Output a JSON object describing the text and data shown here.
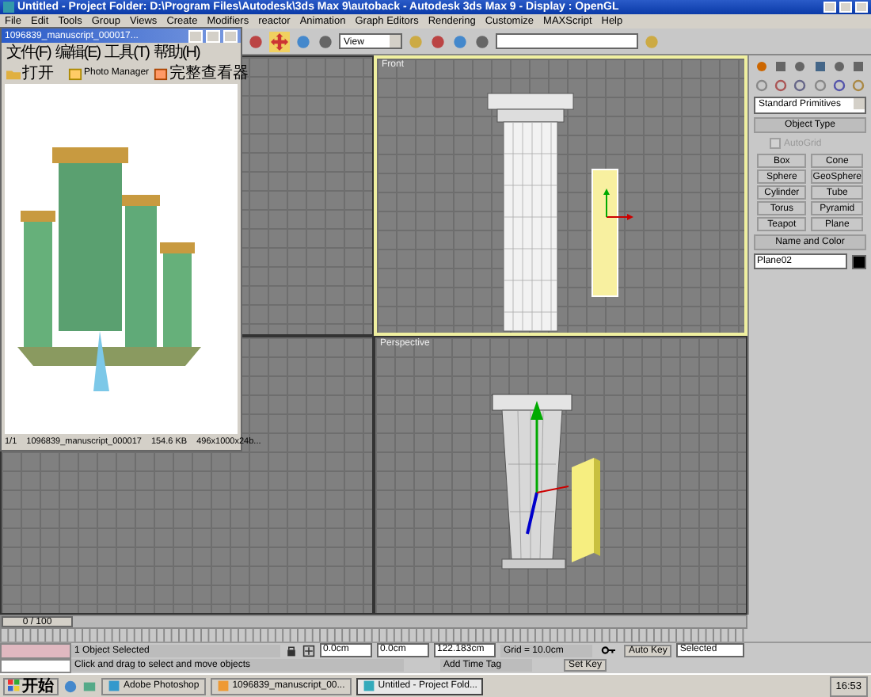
{
  "window": {
    "title": "Untitled - Project Folder: D:\\Program Files\\Autodesk\\3ds Max 9\\autoback - Autodesk 3ds Max 9 - Display : OpenGL"
  },
  "menu": [
    "File",
    "Edit",
    "Tools",
    "Group",
    "Views",
    "Create",
    "Modifiers",
    "reactor",
    "Animation",
    "Graph Editors",
    "Rendering",
    "Customize",
    "MAXScript",
    "Help"
  ],
  "toolbar": {
    "view_dropdown": "View"
  },
  "viewports": [
    {
      "kind": "empty",
      "active": false
    },
    {
      "kind": "front",
      "label": "Front",
      "active": true
    },
    {
      "kind": "empty",
      "active": false
    },
    {
      "kind": "perspective",
      "label": "Perspective",
      "active": false
    }
  ],
  "image_viewer": {
    "title": "1096839_manuscript_000017...",
    "menu": [
      "文件(F)",
      "编辑(E)",
      "工具(T)",
      "帮助(H)"
    ],
    "open_button": "打开",
    "photo_manager": "Photo Manager",
    "full_viewer": "完整查看器",
    "status": [
      "1/1",
      "1096839_manuscript_000017",
      "154.6 KB",
      "496x1000x24b..."
    ]
  },
  "command_panel": {
    "dropdown": "Standard Primitives",
    "object_type": {
      "title": "Object Type",
      "autogrid": {
        "label": "AutoGrid",
        "checked": false,
        "disabled": true
      },
      "buttons": [
        "Box",
        "Cone",
        "Sphere",
        "GeoSphere",
        "Cylinder",
        "Tube",
        "Torus",
        "Pyramid",
        "Teapot",
        "Plane"
      ]
    },
    "name_and_color": {
      "title": "Name and Color",
      "name": "Plane02",
      "color": "#000000"
    }
  },
  "time_slider": {
    "label": "0 / 100",
    "level": 0
  },
  "status": {
    "selection": "1 Object Selected",
    "prompt": "Click and drag to select and move objects",
    "x": "0.0cm",
    "y": "0.0cm",
    "z": "122.183cm",
    "grid": "Grid = 10.0cm",
    "time_tag": "Add Time Tag",
    "auto_key": "Auto Key",
    "key_filter": "Selected",
    "set_key": "Set Key"
  },
  "taskbar": {
    "start": "开始",
    "tasks": [
      {
        "label": "Adobe Photoshop",
        "selected": false
      },
      {
        "label": "1096839_manuscript_00...",
        "selected": false
      },
      {
        "label": "Untitled - Project Fold...",
        "selected": true
      }
    ],
    "clock": "16:53"
  }
}
